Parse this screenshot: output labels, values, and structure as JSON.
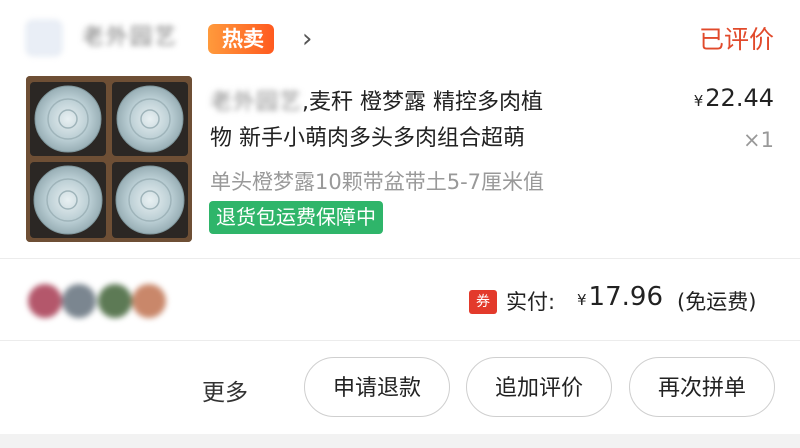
{
  "store": {
    "name": "老外园艺",
    "badge": "热卖",
    "chevron": "›"
  },
  "order": {
    "status": "已评价"
  },
  "product": {
    "title_prefix": "老外园艺",
    "title_line1_rest": ",麦秆 橙梦露 精控多肉植",
    "title_line2": "物 新手小萌肉多头多肉组合超萌",
    "sku": "单头橙梦露10颗带盆带土5-7厘米值",
    "guarantee": "退货包运费保障中",
    "price_symbol": "¥",
    "price": "22.44",
    "quantity": "×1"
  },
  "summary": {
    "coupon_badge": "券",
    "paid_label": "实付:",
    "currency": "¥",
    "paid_amount": "17.96",
    "shipping_note": "(免运费)"
  },
  "actions": {
    "more": "更多",
    "refund": "申请退款",
    "add_review": "追加评价",
    "rebuy": "再次拼单"
  },
  "colors": {
    "status_red": "#e14a2b",
    "guarantee_green": "#2fb56a",
    "coupon_red": "#e33a2b",
    "hot_badge_orange": "#ff5a1f"
  }
}
